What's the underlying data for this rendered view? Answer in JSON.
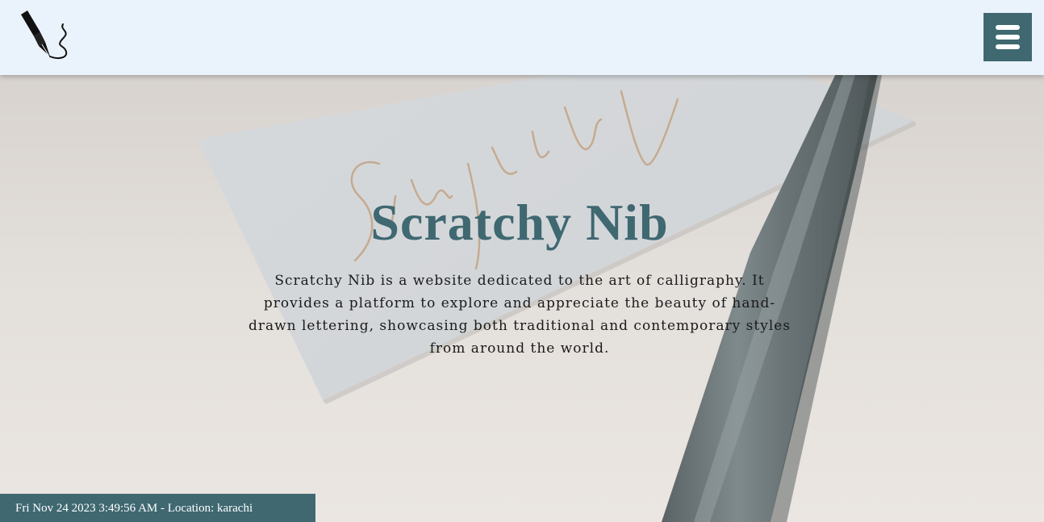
{
  "header": {
    "logo_icon": "fountain-pen-nib-icon",
    "menu_icon": "hamburger-menu-icon"
  },
  "hero": {
    "background_image": "calligraphy card with pen",
    "card_text": "Simplify",
    "title": "Scratchy Nib",
    "description": "Scratchy Nib is a website dedicated to the art of calligraphy. It provides a platform to explore and appreciate the beauty of hand-drawn lettering, showcasing both traditional and contemporary styles from around the world."
  },
  "status": {
    "text": "Fri Nov 24 2023 3:49:56 AM - Location: karachi"
  },
  "colors": {
    "header_bg": "#eaf3fc",
    "accent": "#3f6871",
    "text": "#1a1a1a"
  }
}
